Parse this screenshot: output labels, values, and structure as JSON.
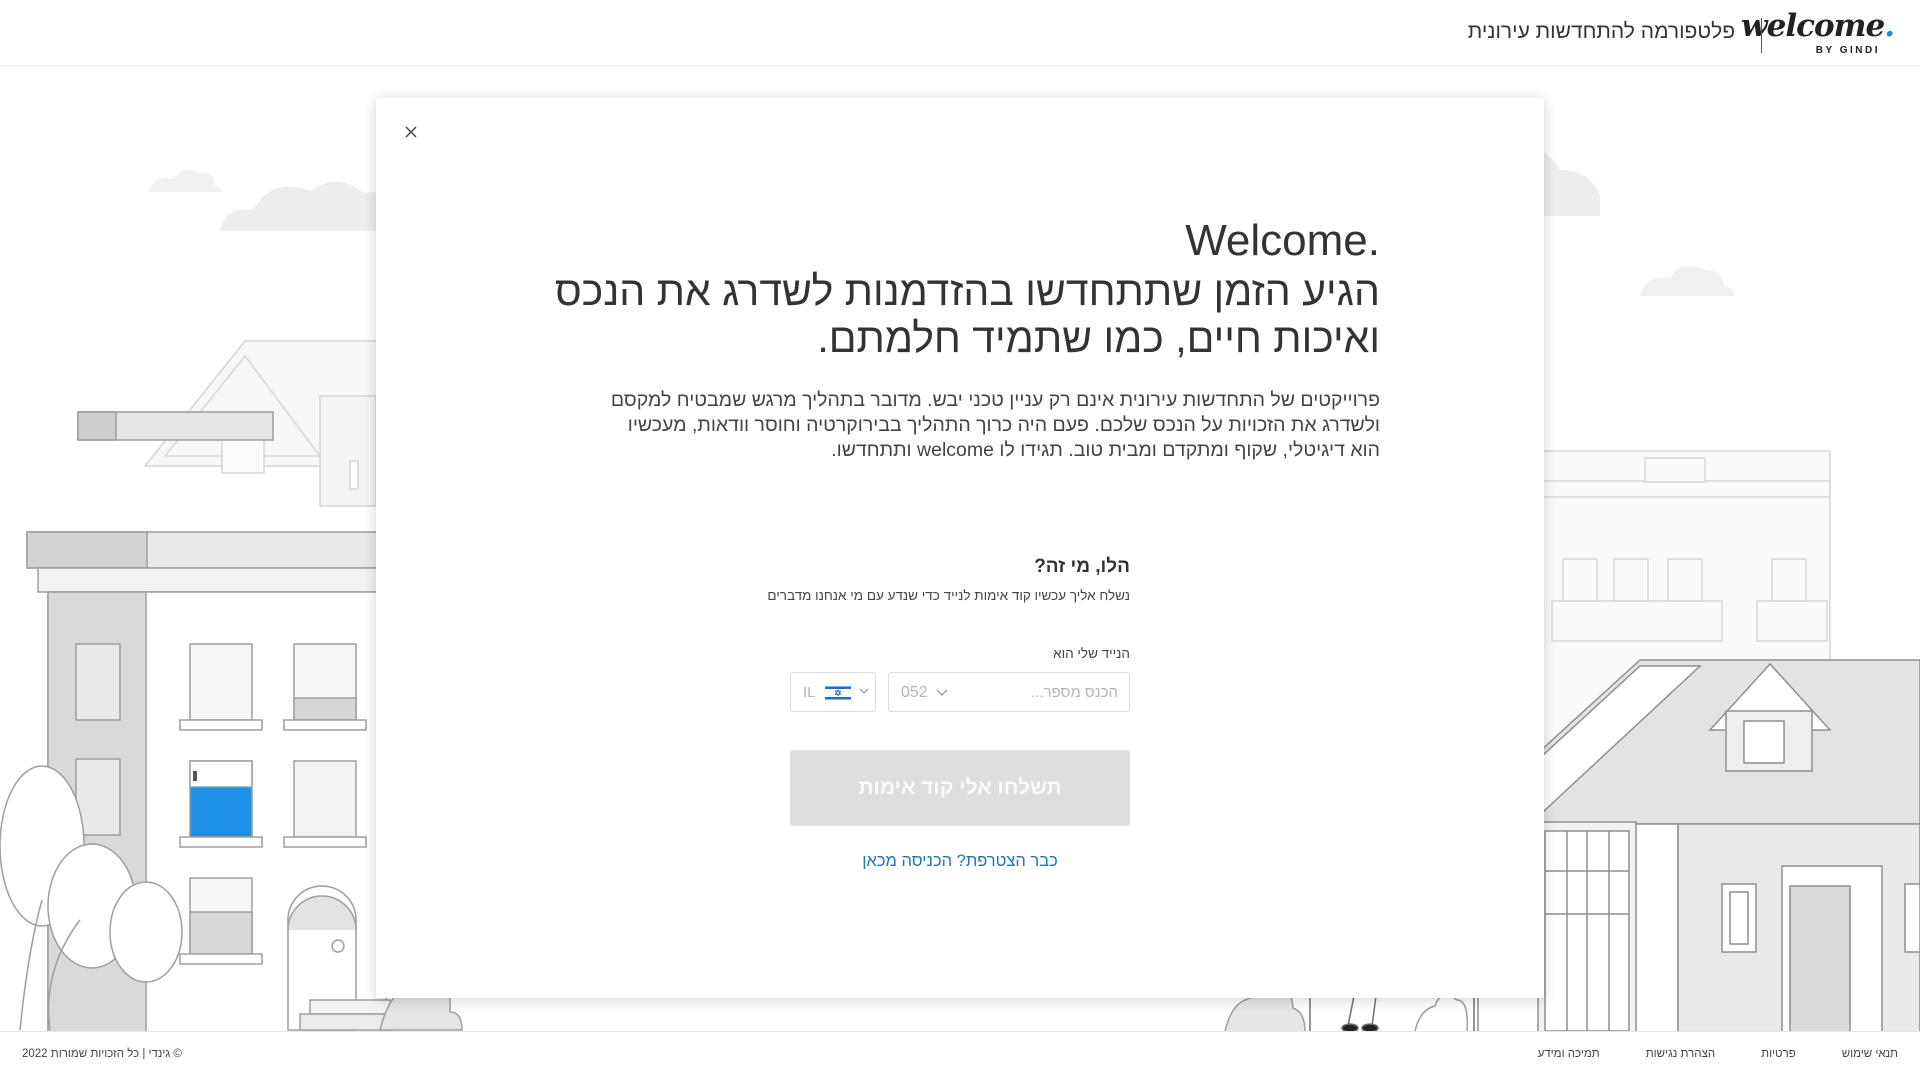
{
  "header": {
    "logo_text": "welcome",
    "logo_dot": ".",
    "logo_sub": "BY GINDI",
    "tagline": "פלטפורמה להתחדשות עירונית"
  },
  "modal": {
    "welcome_title": "Welcome.",
    "headline_line1": "הגיע הזמן שתתחדשו בהזדמנות לשדרג את הנכס",
    "headline_line2": "ואיכות חיים, כמו שתמיד חלמתם.",
    "description": "פרוייקטים של התחדשות עירונית אינם רק עניין טכני יבש. מדובר בתהליך מרגש שמבטיח למקסם ולשדרג את הזכויות על הנכס שלכם. פעם היה כרוך התהליך בבירוקרטיה וחוסר וודאות, מעכשיו הוא דיגיטלי, שקוף ומתקדם ומבית טוב. תגידו לו welcome ותתחדשו.",
    "form": {
      "title": "הלו, מי זה?",
      "subtitle": "נשלח אליך עכשיו קוד אימות לנייד כדי שנדע עם מי אנחנו מדברים",
      "phone_label": "הנייד שלי הוא",
      "phone_placeholder": "הכנס מספר...",
      "prefix_value": "052",
      "country_code": "IL",
      "submit_label": "תשלחו אלי קוד אימות",
      "login_link": "כבר הצטרפת? הכניסה מכאן"
    }
  },
  "footer": {
    "copyright": "© גינדי | כל הזכויות שמורות 2022",
    "links": [
      "תנאי שימוש",
      "פרטיות",
      "הצהרת נגישות",
      "תמיכה ומידע"
    ]
  },
  "colors": {
    "accent_blue": "#1e88e5",
    "link_blue": "#1a73c9",
    "button_disabled": "#dedede"
  },
  "icons": [
    "close-icon",
    "chevron-down-icon",
    "israel-flag-icon"
  ]
}
